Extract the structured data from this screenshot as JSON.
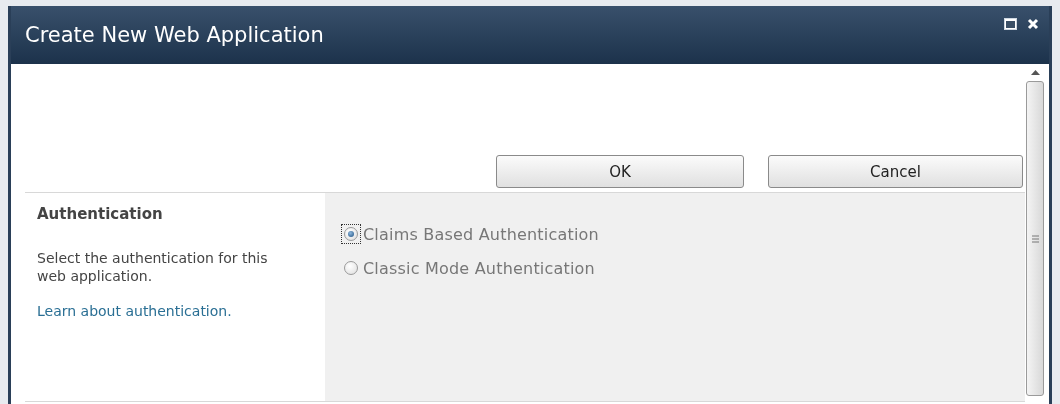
{
  "window": {
    "title": "Create New Web Application"
  },
  "buttons": [
    "OK",
    "Cancel"
  ],
  "section": {
    "title": "Authentication",
    "description": "Select the authentication for this web application.",
    "link": "Learn about authentication.",
    "options": [
      {
        "label": "Claims Based Authentication",
        "selected": true
      },
      {
        "label": "Classic Mode Authentication",
        "selected": false
      }
    ]
  }
}
